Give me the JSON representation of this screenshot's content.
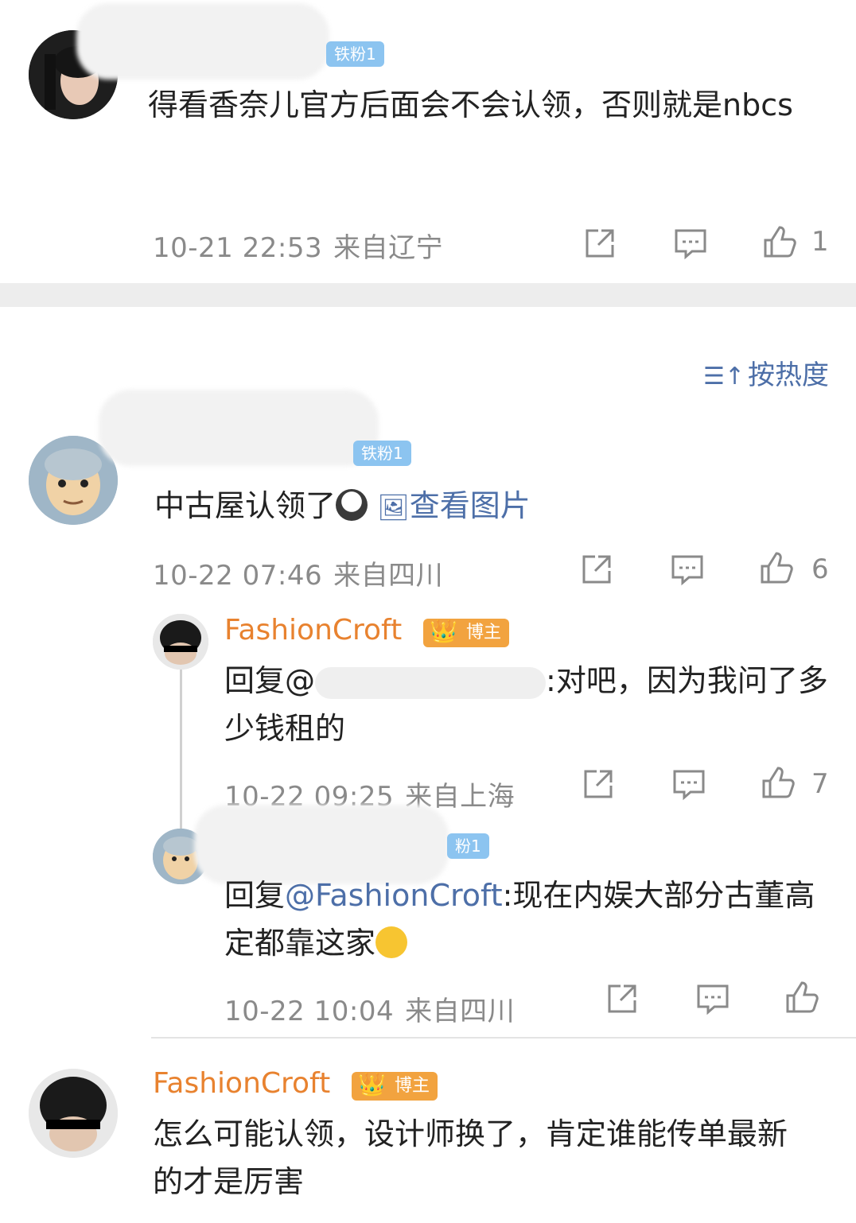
{
  "comments": [
    {
      "badge": "铁粉1",
      "text": "得看香奈儿官方后面会不会认领，否则就是nbcs",
      "time": "10-21 22:53",
      "location": "来自辽宁",
      "likes": "1"
    },
    {
      "badge": "铁粉1",
      "text": "中古屋认领了",
      "link": "查看图片",
      "time": "10-22 07:46",
      "location": "来自四川",
      "likes": "6"
    }
  ],
  "sort_label": "按热度",
  "replies": [
    {
      "username": "FashionCroft",
      "badge": "博主",
      "prefix": "回复@",
      "tail": ":对吧，因为我问了多少钱租的",
      "time": "10-22 09:25",
      "location": "来自上海",
      "likes": "7"
    },
    {
      "badge_partial": "粉1",
      "prefix": "回复",
      "mention": "@FashionCroft",
      "text": ":现在内娱大部分古董高定都靠这家",
      "time": "10-22 10:04",
      "location": "来自四川"
    }
  ],
  "bottom_comment": {
    "username": "FashionCroft",
    "badge": "博主",
    "text": "怎么可能认领，设计师换了，肯定谁能传单最新的才是厉害"
  },
  "colors": {
    "link": "#4d6fa8",
    "username": "#e8822f",
    "badge_blue": "#8cc4f0"
  }
}
